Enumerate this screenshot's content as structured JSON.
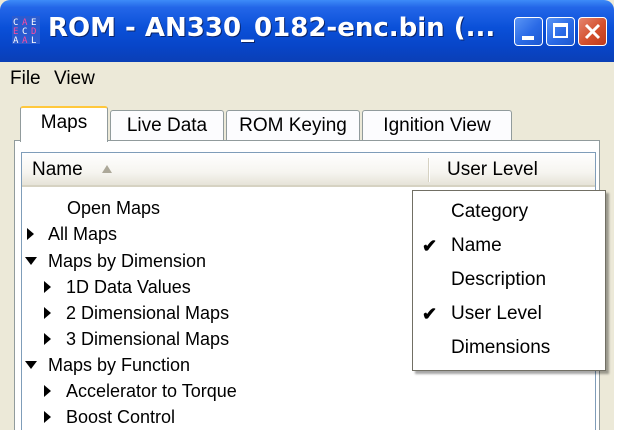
{
  "window": {
    "title": "ROM - AN330_0182-enc.bin (...",
    "app_icon": "app-logo-icon",
    "controls": [
      "minimize-icon",
      "maximize-icon",
      "close-icon"
    ]
  },
  "menu": {
    "items": [
      "File",
      "View"
    ]
  },
  "tabs": [
    {
      "label": "Maps",
      "active": true
    },
    {
      "label": "Live Data",
      "active": false
    },
    {
      "label": "ROM Keying",
      "active": false
    },
    {
      "label": "Ignition View",
      "active": false
    }
  ],
  "columns": {
    "name": "Name",
    "user_level": "User Level",
    "sorted_by": "Name"
  },
  "tree": [
    {
      "label": "Open Maps",
      "indent": 0,
      "expander": "none"
    },
    {
      "label": "All Maps",
      "indent": 0,
      "expander": "collapsed"
    },
    {
      "label": "Maps by Dimension",
      "indent": 0,
      "expander": "expanded"
    },
    {
      "label": "1D Data Values",
      "indent": 1,
      "expander": "collapsed"
    },
    {
      "label": "2 Dimensional Maps",
      "indent": 1,
      "expander": "collapsed"
    },
    {
      "label": "3 Dimensional Maps",
      "indent": 1,
      "expander": "collapsed"
    },
    {
      "label": "Maps by Function",
      "indent": 0,
      "expander": "expanded"
    },
    {
      "label": "Accelerator to Torque",
      "indent": 1,
      "expander": "collapsed"
    },
    {
      "label": "Boost Control",
      "indent": 1,
      "expander": "collapsed"
    }
  ],
  "column_menu": [
    {
      "label": "Category",
      "checked": false
    },
    {
      "label": "Name",
      "checked": true
    },
    {
      "label": "Description",
      "checked": false
    },
    {
      "label": "User Level",
      "checked": true
    },
    {
      "label": "Dimensions",
      "checked": false
    }
  ],
  "colors": {
    "titlebar": "#0a50d8",
    "window_bg": "#ece9d8",
    "close_button": "#d4502e",
    "active_tab_highlight": "#ffc83c"
  }
}
